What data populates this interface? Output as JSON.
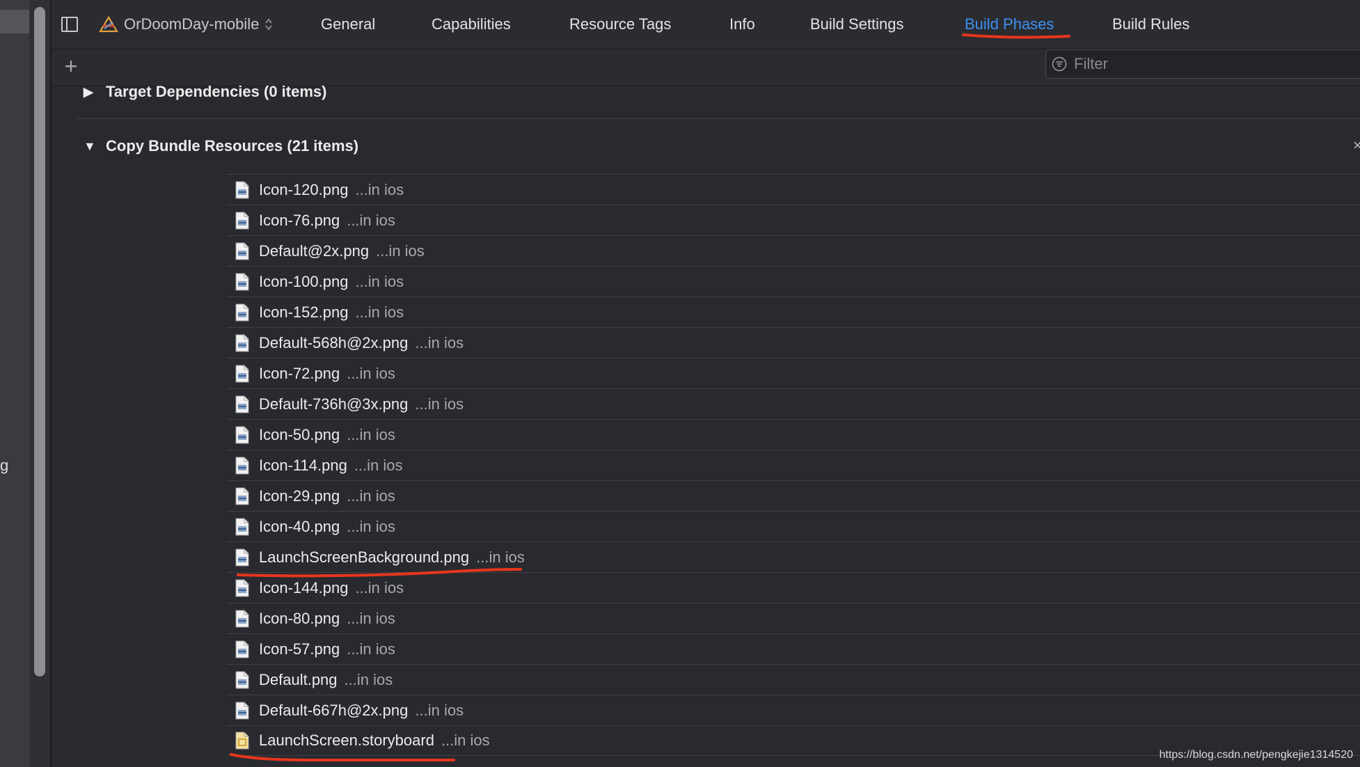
{
  "header": {
    "target_name": "OrDoomDay-mobile",
    "tabs": [
      {
        "label": "General"
      },
      {
        "label": "Capabilities"
      },
      {
        "label": "Resource Tags"
      },
      {
        "label": "Info"
      },
      {
        "label": "Build Settings"
      },
      {
        "label": "Build Phases",
        "active": true
      },
      {
        "label": "Build Rules"
      }
    ],
    "accent_color": "#3d8ff2"
  },
  "filter": {
    "placeholder": "Filter"
  },
  "left_pane": {
    "cut_text": "g"
  },
  "phases": {
    "target_dependencies": "Target Dependencies (0 items)",
    "copy_bundle_resources": "Copy Bundle Resources (21 items)"
  },
  "resources": [
    {
      "name": "Icon-120.png",
      "location": "...in ios"
    },
    {
      "name": "Icon-76.png",
      "location": "...in ios"
    },
    {
      "name": "Default@2x.png",
      "location": "...in ios"
    },
    {
      "name": "Icon-100.png",
      "location": "...in ios"
    },
    {
      "name": "Icon-152.png",
      "location": "...in ios"
    },
    {
      "name": "Default-568h@2x.png",
      "location": "...in ios"
    },
    {
      "name": "Icon-72.png",
      "location": "...in ios"
    },
    {
      "name": "Default-736h@3x.png",
      "location": "...in ios"
    },
    {
      "name": "Icon-50.png",
      "location": "...in ios"
    },
    {
      "name": "Icon-114.png",
      "location": "...in ios"
    },
    {
      "name": "Icon-29.png",
      "location": "...in ios"
    },
    {
      "name": "Icon-40.png",
      "location": "...in ios"
    },
    {
      "name": "LaunchScreenBackground.png",
      "location": "...in ios"
    },
    {
      "name": "Icon-144.png",
      "location": "...in ios"
    },
    {
      "name": "Icon-80.png",
      "location": "...in ios"
    },
    {
      "name": "Icon-57.png",
      "location": "...in ios"
    },
    {
      "name": "Default.png",
      "location": "...in ios"
    },
    {
      "name": "Default-667h@2x.png",
      "location": "...in ios"
    },
    {
      "name": "LaunchScreen.storyboard",
      "location": "...in ios",
      "type": "storyboard"
    }
  ],
  "watermark": "https://blog.csdn.net/pengkejie1314520",
  "annotation_color": "#e8361e"
}
